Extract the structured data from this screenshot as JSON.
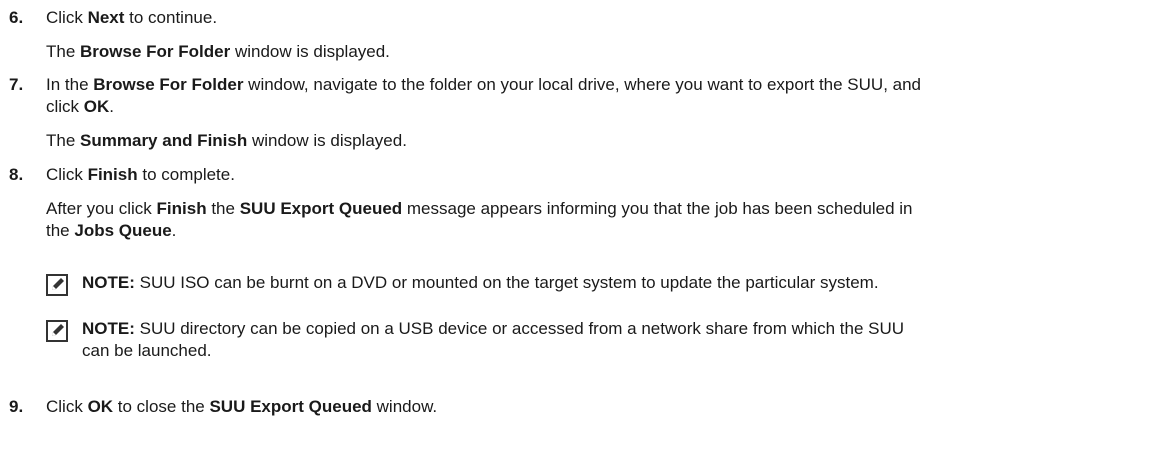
{
  "steps": [
    {
      "number": "6.",
      "line1": {
        "pre": "Click ",
        "b1": "Next",
        "post": " to continue."
      },
      "line2": {
        "pre": "The ",
        "b1": "Browse For Folder",
        "post": " window is displayed."
      }
    },
    {
      "number": "7.",
      "line1": {
        "pre": "In the ",
        "b1": "Browse For Folder",
        "post": " window, navigate to the folder on your local drive, where you want to export the SUU, and"
      },
      "line1b": {
        "pre": "click ",
        "b1": "OK",
        "post": "."
      },
      "line2": {
        "pre": "The ",
        "b1": "Summary and Finish",
        "post": " window is displayed."
      }
    },
    {
      "number": "8.",
      "line1": {
        "pre": "Click ",
        "b1": "Finish",
        "post": " to complete."
      },
      "line2": {
        "pre": "After you click ",
        "b1": "Finish",
        "mid": " the ",
        "b2": "SUU Export Queued",
        "post": " message appears informing you that the job has been scheduled in"
      },
      "line2b": {
        "pre": "the ",
        "b1": "Jobs Queue",
        "post": "."
      }
    },
    {
      "number": "9.",
      "line1": {
        "pre": "Click ",
        "b1": "OK",
        "mid": " to close the ",
        "b2": "SUU Export Queued",
        "post": " window."
      }
    }
  ],
  "notes": [
    {
      "icon": "note-pencil-icon",
      "label": "NOTE:",
      "line1": " SUU ISO can be burnt on a DVD or mounted on the target system to update the particular system."
    },
    {
      "icon": "note-pencil-icon",
      "label": "NOTE:",
      "line1": " SUU directory can be copied on a USB device or accessed from a network share from which the SUU",
      "line2": "can be launched."
    }
  ]
}
